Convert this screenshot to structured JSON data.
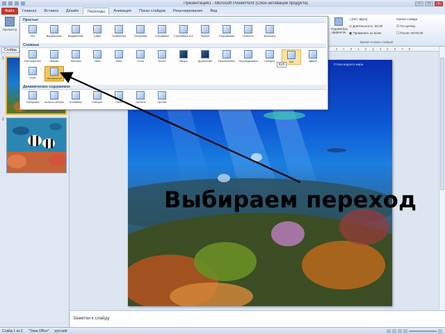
{
  "window": {
    "title": "Презентация1 - Microsoft PowerPoint (Сбой активации продукта)"
  },
  "tabs": [
    "Файл",
    "Главная",
    "Вставка",
    "Дизайн",
    "Переходы",
    "Анимация",
    "Показ слайдов",
    "Рецензирование",
    "Вид"
  ],
  "active_tab_index": 4,
  "ribbon": {
    "preview_label": "Просмотр",
    "effect_options_label": "Параметры эффектов",
    "sound_label": "[Нет звука]",
    "duration_label": "Длительность: 00,00",
    "apply_all_label": "Применить ко всем",
    "advance_label": "Смена слайда",
    "on_click_label": "По щелчку",
    "after_label": "После: 00:00,00",
    "group_timing": "Время показа слайдов"
  },
  "gallery": {
    "sections": [
      {
        "title": "Простые",
        "items": [
          "Нет",
          "Выцветание",
          "Выдвигание",
          "Сдвиг",
          "Появление",
          "Панорама",
          "Случайные",
          "Случайные полосы",
          "Форма",
          "Открывание",
          "Новости",
          "Вспышка"
        ]
      },
      {
        "title": "Сложные",
        "items": [
          "Растворение",
          "Шашки",
          "Жалюзи",
          "Часы",
          "Рябь",
          "Соты",
          "Блеск",
          "Вихрь",
          "Дробление",
          "Выключение",
          "Опрокидывание",
          "Галерея",
          "Куб",
          "Двери"
        ]
      },
      {
        "title": "",
        "items": [
          "Поле",
          "Увеличение"
        ]
      },
      {
        "title": "Динамическое содержимое",
        "items": [
          "Панорама",
          "Колесо обозрения",
          "Конвейер",
          "Поворот",
          "Окно",
          "Орбита",
          "Пролёт"
        ]
      }
    ],
    "highlighted_item": "Куб",
    "selected_item": "Увеличение",
    "tooltip": "Куб"
  },
  "ruler": {
    "text": "· 2 · 1 · 0 · 1 · 2 · 3 · 4 · 5 · 6 · 7 · 8 ·"
  },
  "left_panel": {
    "tab_label": "Слайды",
    "slide_numbers": [
      "1",
      "2"
    ]
  },
  "slide": {
    "caption": "Выбираем переход",
    "corner_text": "Стена водного мира"
  },
  "notes": {
    "placeholder": "Заметки к слайду"
  },
  "status": {
    "slide_info": "Слайд 1 из 2",
    "theme": "\"Тема Office\"",
    "language": "русский"
  },
  "colors": {
    "accent_tab": "#c0392b",
    "selection": "#f6c653",
    "highlight": "#fbe3a5",
    "ribbon_border": "#9fb4d3"
  }
}
